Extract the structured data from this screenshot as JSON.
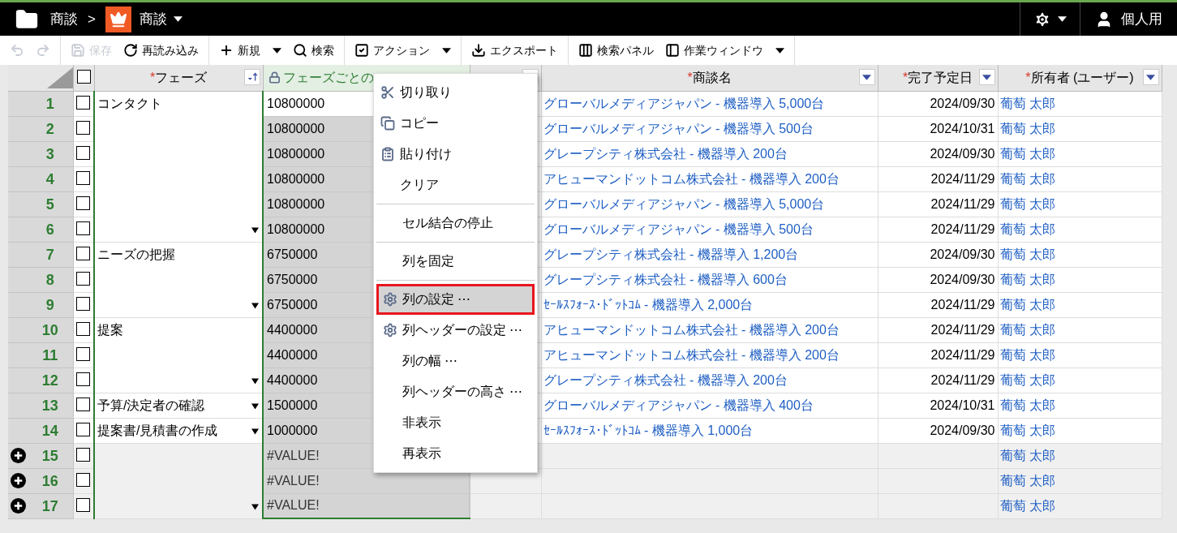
{
  "app_bar": {
    "breadcrumb": [
      {
        "label": "商談"
      },
      {
        "label": "商談",
        "has_menu": true
      }
    ],
    "separator": ">",
    "user": "個人用"
  },
  "toolbar": {
    "groups": [
      [
        {
          "disabled": true
        },
        {
          "disabled": true
        }
      ],
      [
        {
          "label": "保存",
          "disabled": true
        },
        {
          "label": "再読み込み",
          "disabled": false
        }
      ],
      [
        {
          "label": "新規",
          "disabled": false,
          "has_menu": true
        },
        {
          "label": "検索",
          "disabled": false
        }
      ],
      [
        {
          "label": "アクション",
          "disabled": false,
          "has_menu": true
        }
      ],
      [
        {
          "label": "エクスポート",
          "disabled": false
        }
      ],
      [
        {
          "label": "検索パネル",
          "disabled": false
        },
        {
          "label": "作業ウィンドウ",
          "disabled": false,
          "has_menu": true
        }
      ]
    ]
  },
  "table": {
    "header_checked": false,
    "required_mark": "*",
    "columns": [
      {
        "label": "フェーズ",
        "required": true,
        "selected": false,
        "locked": false
      },
      {
        "label": "フェーズごとの",
        "required": false,
        "selected": true,
        "locked": true
      },
      {
        "has_filter": true
      },
      {
        "label": "商談名",
        "required": true,
        "selected": false,
        "locked": false,
        "has_filter": true
      },
      {
        "label": "完了予定日",
        "required": true,
        "selected": false,
        "locked": false,
        "has_filter": true
      },
      {
        "label": "所有者 (ユーザー)",
        "required": true,
        "selected": false,
        "locked": false,
        "has_filter": true
      }
    ],
    "groups": [
      {
        "phase": "コンタクト",
        "rows": [
          {
            "number": "1",
            "checked": false,
            "kind": "record",
            "active": true,
            "total": "10800000",
            "deal": "グローバルメディアジャパン - 機器導入 5,000台",
            "due": "2024/09/30",
            "owner": "葡萄 太郎"
          },
          {
            "number": "2",
            "checked": false,
            "kind": "record",
            "active": false,
            "total": "10800000",
            "deal": "グローバルメディアジャパン - 機器導入 500台",
            "due": "2024/10/31",
            "owner": "葡萄 太郎"
          },
          {
            "number": "3",
            "checked": false,
            "kind": "record",
            "active": false,
            "total": "10800000",
            "deal": "グレープシティ株式会社 - 機器導入 200台",
            "due": "2024/09/30",
            "owner": "葡萄 太郎"
          },
          {
            "number": "4",
            "checked": false,
            "kind": "record",
            "active": false,
            "total": "10800000",
            "deal": "アヒューマンドットコム株式会社 - 機器導入 200台",
            "due": "2024/11/29",
            "owner": "葡萄 太郎"
          },
          {
            "number": "5",
            "checked": false,
            "kind": "record",
            "active": false,
            "total": "10800000",
            "deal": "グローバルメディアジャパン - 機器導入 5,000台",
            "due": "2024/11/29",
            "owner": "葡萄 太郎"
          },
          {
            "number": "6",
            "checked": false,
            "kind": "record",
            "active": false,
            "total": "10800000",
            "deal": "グローバルメディアジャパン - 機器導入 500台",
            "due": "2024/11/29",
            "owner": "葡萄 太郎"
          }
        ]
      },
      {
        "phase": "ニーズの把握",
        "rows": [
          {
            "number": "7",
            "checked": false,
            "kind": "record",
            "active": false,
            "total": "6750000",
            "deal": "グレープシティ株式会社 - 機器導入 1,200台",
            "due": "2024/09/30",
            "owner": "葡萄 太郎"
          },
          {
            "number": "8",
            "checked": false,
            "kind": "record",
            "active": false,
            "total": "6750000",
            "deal": "グレープシティ株式会社 - 機器導入 600台",
            "due": "2024/09/30",
            "owner": "葡萄 太郎"
          },
          {
            "number": "9",
            "checked": false,
            "kind": "record",
            "active": false,
            "total": "6750000",
            "deal": "ｾｰﾙｽﾌｫｰｽ･ﾄﾞｯﾄｺﾑ - 機器導入 2,000台",
            "due": "2024/11/29",
            "owner": "葡萄 太郎"
          }
        ]
      },
      {
        "phase": "提案",
        "rows": [
          {
            "number": "10",
            "checked": false,
            "kind": "record",
            "active": false,
            "total": "4400000",
            "deal": "アヒューマンドットコム株式会社 - 機器導入 200台",
            "due": "2024/11/29",
            "owner": "葡萄 太郎"
          },
          {
            "number": "11",
            "checked": false,
            "kind": "record",
            "active": false,
            "total": "4400000",
            "deal": "アヒューマンドットコム株式会社 - 機器導入 200台",
            "due": "2024/11/29",
            "owner": "葡萄 太郎"
          },
          {
            "number": "12",
            "checked": false,
            "kind": "record",
            "active": false,
            "total": "4400000",
            "deal": "グレープシティ株式会社 - 機器導入 200台",
            "due": "2024/11/29",
            "owner": "葡萄 太郎"
          }
        ]
      },
      {
        "phase": "予算/決定者の確認",
        "rows": [
          {
            "number": "13",
            "checked": false,
            "kind": "record",
            "active": false,
            "total": "1500000",
            "deal": "グローバルメディアジャパン - 機器導入 400台",
            "due": "2024/10/31",
            "owner": "葡萄 太郎"
          }
        ]
      },
      {
        "phase": "提案書/見積書の作成",
        "rows": [
          {
            "number": "14",
            "checked": false,
            "kind": "record",
            "active": false,
            "total": "1000000",
            "deal": "ｾｰﾙｽﾌｫｰｽ･ﾄﾞｯﾄｺﾑ - 機器導入 1,000台",
            "due": "2024/09/30",
            "owner": "葡萄 太郎"
          }
        ]
      },
      {
        "rows": [
          {
            "number": "15",
            "checked": false,
            "kind": "new",
            "active": false,
            "total": "#VALUE!",
            "owner": "葡萄 太郎"
          },
          {
            "number": "16",
            "checked": false,
            "kind": "new",
            "active": false,
            "total": "#VALUE!",
            "owner": "葡萄 太郎"
          },
          {
            "number": "17",
            "checked": false,
            "kind": "new",
            "active": false,
            "total": "#VALUE!",
            "owner": "葡萄 太郎"
          }
        ]
      }
    ]
  },
  "context_menu": {
    "groups": [
      [
        {
          "label": "切り取り",
          "selected": false
        },
        {
          "label": "コピー",
          "selected": false
        },
        {
          "label": "貼り付け",
          "selected": false
        },
        {
          "label": "クリア",
          "selected": false
        }
      ],
      [
        {
          "label": "セル結合の停止",
          "selected": false
        }
      ],
      [
        {
          "label": "列を固定",
          "selected": false
        }
      ],
      [
        {
          "label": "列の設定 ⋯",
          "selected": true
        },
        {
          "label": "列ヘッダーの設定 ⋯",
          "selected": false
        },
        {
          "label": "列の幅 ⋯",
          "selected": false
        },
        {
          "label": "列ヘッダーの高さ ⋯",
          "selected": false
        },
        {
          "label": "非表示",
          "selected": false
        },
        {
          "label": "再表示",
          "selected": false
        }
      ]
    ]
  }
}
